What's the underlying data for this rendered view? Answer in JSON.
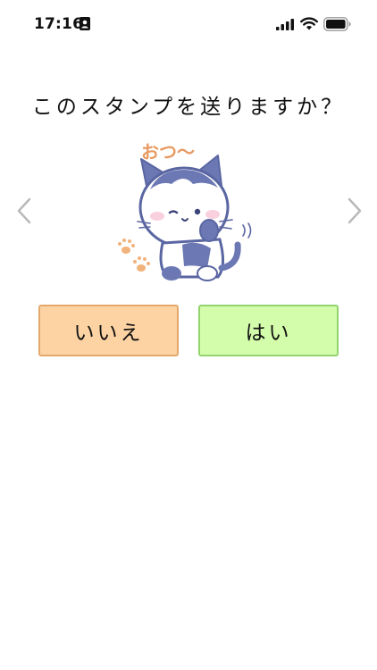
{
  "status_bar": {
    "time": "17:16",
    "icons": [
      "id-card-icon",
      "cellular-signal-icon",
      "wifi-icon",
      "battery-icon"
    ]
  },
  "dialog": {
    "question": "このスタンプを送りますか？",
    "prev_icon": "chevron-left-icon",
    "next_icon": "chevron-right-icon",
    "sticker": {
      "caption": "おつ～",
      "character": "cat-icon"
    },
    "buttons": {
      "no_label": "いいえ",
      "yes_label": "はい"
    }
  },
  "colors": {
    "no_button_bg": "#fdd3a3",
    "no_button_border": "#e4a86b",
    "yes_button_bg": "#d4fdab",
    "yes_button_border": "#93d46e",
    "sticker_caption": "#e89a62",
    "sticker_outline": "#6b78b4",
    "arrow": "#b8b8b8"
  }
}
